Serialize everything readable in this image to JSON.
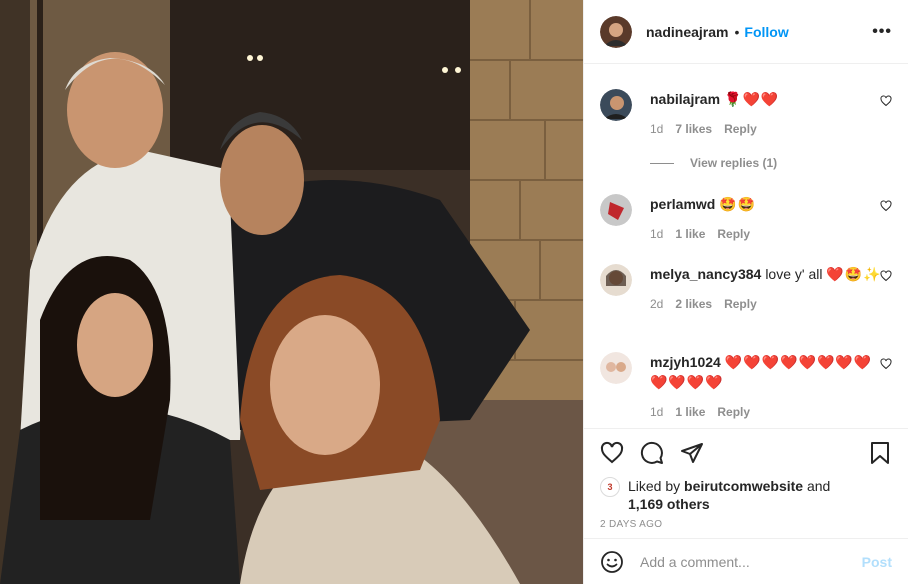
{
  "post": {
    "username": "nadineajram",
    "follow_label": "Follow",
    "more_label": "•••",
    "separator": "•"
  },
  "comments": [
    {
      "username": "nabilajram",
      "text": "",
      "emoji": "🌹❤️❤️",
      "time": "1d",
      "likes": "7 likes",
      "reply": "Reply",
      "view_replies": "View replies (1)"
    },
    {
      "username": "perlamwd",
      "text": "",
      "emoji": "🤩🤩",
      "time": "1d",
      "likes": "1 like",
      "reply": "Reply"
    },
    {
      "username": "melya_nancy384",
      "text": "love y' all",
      "emoji": "❤️🤩✨",
      "time": "2d",
      "likes": "2 likes",
      "reply": "Reply"
    },
    {
      "username": "mzjyh1024",
      "text": "",
      "emoji": "❤️❤️❤️❤️❤️❤️❤️❤️❤️❤️❤️❤️",
      "time": "1d",
      "likes": "1 like",
      "reply": "Reply"
    }
  ],
  "likes": {
    "prefix": "Liked by",
    "user": "beirutcomwebsite",
    "conjunction": "and",
    "others": "1,169 others",
    "mini_avatar_label": "3"
  },
  "timestamp": "2 days ago",
  "add_comment": {
    "placeholder": "Add a comment...",
    "post_label": "Post"
  },
  "icons": {
    "like": "heart-icon",
    "comment": "comment-icon",
    "share": "paper-plane-icon",
    "save": "bookmark-icon",
    "emoji": "smiley-icon",
    "comment_like": "small-heart-icon"
  },
  "colors": {
    "link_blue": "#0095f6",
    "post_disabled": "#b2dffc",
    "muted": "#8e8e8e",
    "heart_red": "#e0245e"
  }
}
